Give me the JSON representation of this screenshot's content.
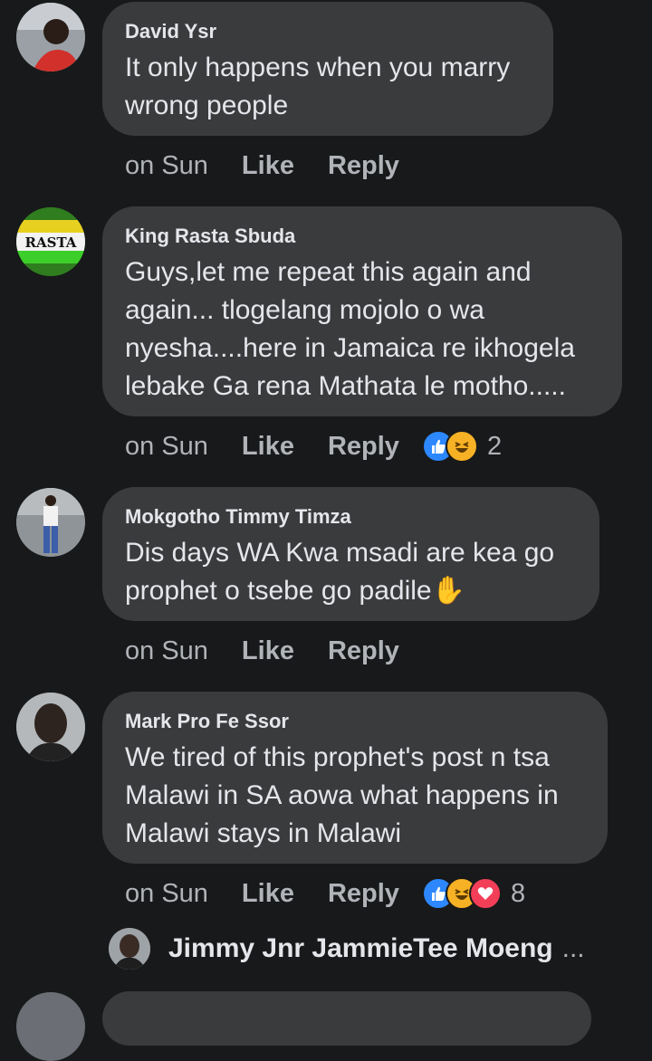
{
  "comments": [
    {
      "author": "David Ysr",
      "text": "It only happens when you marry wrong people",
      "time": "on Sun",
      "like_label": "Like",
      "reply_label": "Reply"
    },
    {
      "author": "King Rasta Sbuda",
      "avatar_text": "RASTA",
      "text": "Guys,let me repeat this again and again... tlogelang mojolo o wa nyesha....here in Jamaica re ikhogela lebake Ga rena Mathata le motho.....",
      "time": "on Sun",
      "like_label": "Like",
      "reply_label": "Reply",
      "reactions": [
        "like",
        "haha"
      ],
      "reaction_count": "2"
    },
    {
      "author": "Mokgotho Timmy Timza",
      "text": "Dis days WA Kwa msadi are kea go prophet o tsebe go padile✋",
      "time": "on Sun",
      "like_label": "Like",
      "reply_label": "Reply"
    },
    {
      "author": "Mark Pro Fe Ssor",
      "text": "We tired of this prophet's post n tsa Malawi in SA aowa what happens in Malawi stays in Malawi",
      "time": "on Sun",
      "like_label": "Like",
      "reply_label": "Reply",
      "reactions": [
        "like",
        "haha",
        "love"
      ],
      "reaction_count": "8"
    }
  ],
  "reply_preview": {
    "name": "Jimmy Jnr JammieTee Moeng",
    "more": "..."
  },
  "colors": {
    "background": "#18191a",
    "bubble": "#3a3b3c",
    "text": "#e4e6eb",
    "muted": "#b0b3b8",
    "like_blue": "#2d88ff",
    "haha_yellow": "#f7b125",
    "love_red": "#f33e58"
  }
}
